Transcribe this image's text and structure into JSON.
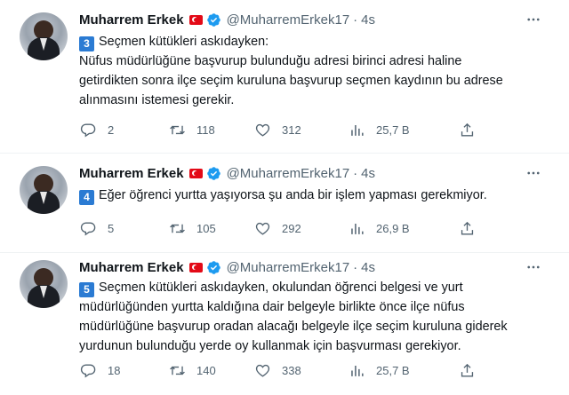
{
  "tweets": [
    {
      "author_name": "Muharrem Erkek",
      "handle": "@MuharremErkek17",
      "separator": "·",
      "time": "4s",
      "number": "3",
      "lines": [
        "Seçmen kütükleri askıdayken:",
        "Nüfus müdürlüğüne başvurup bulunduğu adresi birinci adresi haline",
        "getirdikten sonra ilçe seçim kuruluna başvurup seçmen kaydının bu adrese",
        "alınmasını istemesi gerekir."
      ],
      "replies": "2",
      "retweets": "118",
      "likes": "312",
      "views": "25,7 B"
    },
    {
      "author_name": "Muharrem Erkek",
      "handle": "@MuharremErkek17",
      "separator": "·",
      "time": "4s",
      "number": "4",
      "lines": [
        "Eğer öğrenci yurtta yaşıyorsa şu anda bir işlem yapması gerekmiyor."
      ],
      "replies": "5",
      "retweets": "105",
      "likes": "292",
      "views": "26,9 B"
    },
    {
      "author_name": "Muharrem Erkek",
      "handle": "@MuharremErkek17",
      "separator": "·",
      "time": "4s",
      "number": "5",
      "lines": [
        "Seçmen kütükleri askıdayken, okulundan öğrenci belgesi ve yurt",
        "müdürlüğünden yurtta kaldığına dair belgeyle birlikte önce ilçe nüfus",
        "müdürlüğüne başvurup oradan alacağı belgeyle ilçe seçim kuruluna giderek",
        "yurdunun bulunduğu yerde oy kullanmak için başvurması gerekiyor."
      ],
      "replies": "18",
      "retweets": "140",
      "likes": "338",
      "views": "25,7 B"
    }
  ],
  "icons": {
    "more": "more-horizontal-icon",
    "reply": "reply-icon",
    "retweet": "retweet-icon",
    "like": "heart-icon",
    "views": "views-icon",
    "share": "share-icon",
    "verified": "verified-badge-icon",
    "flag": "turkey-flag-icon"
  },
  "colors": {
    "text": "#0f1419",
    "muted": "#536471",
    "verified": "#1d9bf0",
    "keycap": "#2b7bd3",
    "flag": "#e30a17",
    "divider": "#eff3f4"
  }
}
